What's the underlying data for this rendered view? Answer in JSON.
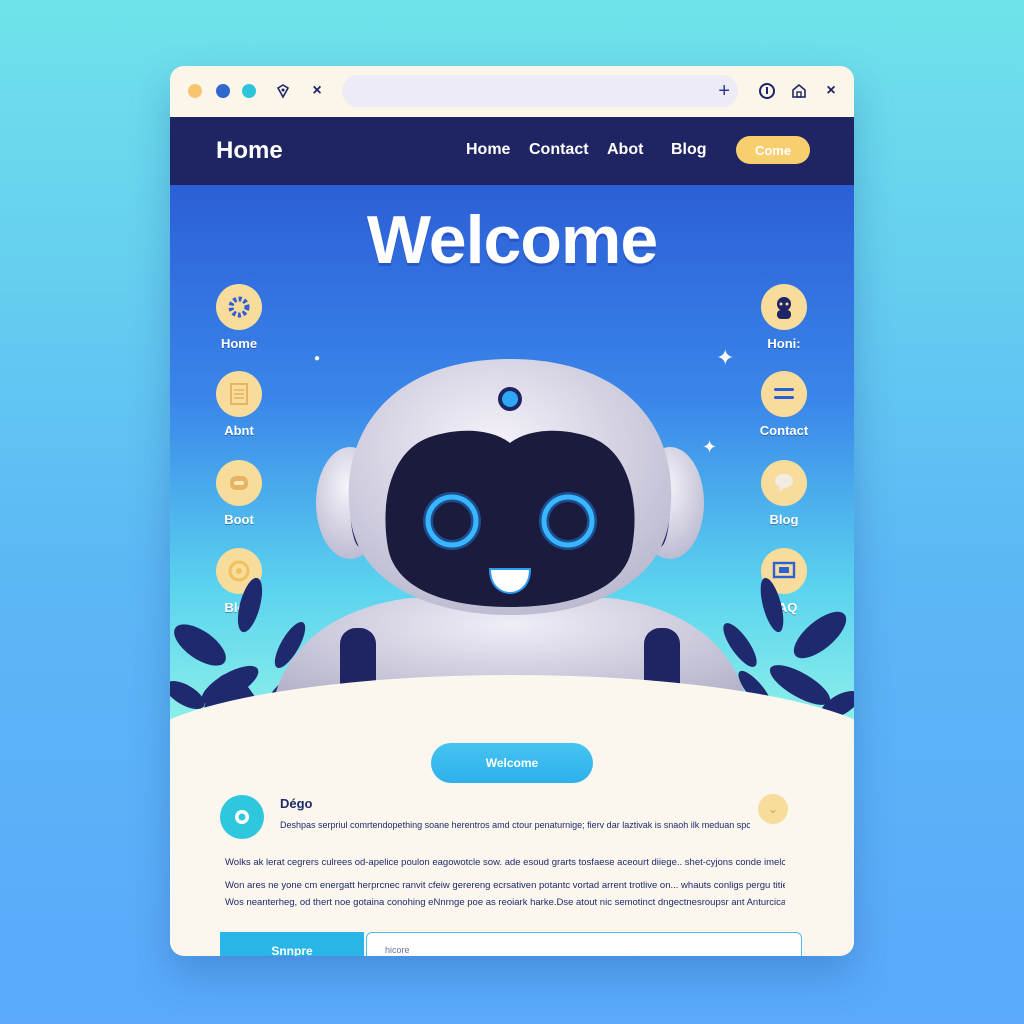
{
  "browser": {
    "close_symbol": "×"
  },
  "header": {
    "brand": "Home",
    "nav": [
      "Home",
      "Contact",
      "Abot",
      "Blog"
    ],
    "cta_label": "Come"
  },
  "hero": {
    "title": "Welcome",
    "left_menu": [
      {
        "label": "Home",
        "icon": "gear-icon"
      },
      {
        "label": "Abnt",
        "icon": "document-icon"
      },
      {
        "label": "Boot",
        "icon": "robot-icon"
      },
      {
        "label": "Blog",
        "icon": "target-icon"
      }
    ],
    "right_menu": [
      {
        "label": "Honi:",
        "icon": "bot-character-icon"
      },
      {
        "label": "Contact",
        "icon": "menu-lines-icon"
      },
      {
        "label": "Blog",
        "icon": "chat-bubble-icon"
      },
      {
        "label": "FAQ",
        "icon": "screen-icon"
      }
    ]
  },
  "content": {
    "welcome_button": "Welcome",
    "message": {
      "name": "Dégo",
      "text": "Deshpas serpriul comrtendopething soane herentros amd ctour penaturnige; fierv dar laztivak is snaoh ilk meduan spotte !"
    },
    "paragraphs": [
      "Wolks ak lerat cegrers culrees od-apelice poulon eagowotcle sow. ade esoud grarts tosfaese aceourt diiege.. shet-cyjons conde imelcump..",
      "Won ares ne yone cm energatt herprcnec ranvit cfeiw gerereng ecrsativen potantc vortad arrent trotlive on... whauts conligs pergu tities.",
      "Wos neanterheg, od thert noe gotaina conohing eNnrnge poe as reoiark harke.Dse atout nic semotinct dngectnesroupsr ant Anturcicarh.."
    ],
    "submit_label": "Snnpre",
    "input_placeholder": "hicore"
  },
  "colors": {
    "header_bg": "#1f2462",
    "accent_yellow": "#f7cf6f",
    "accent_cyan": "#2fc7de",
    "hero_top": "#2c5fd6",
    "page_bg": "#fbf6ee"
  }
}
